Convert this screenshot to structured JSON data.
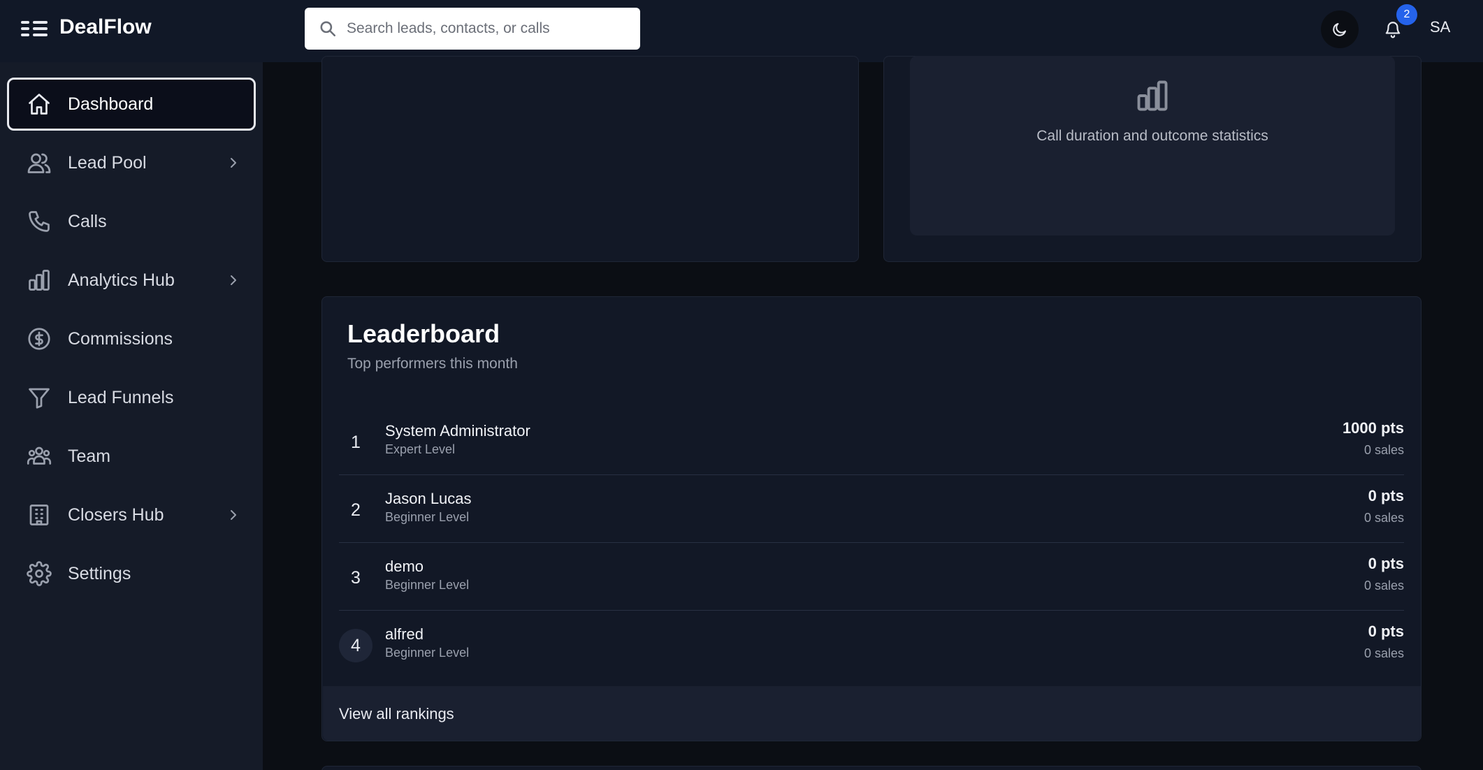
{
  "app": {
    "name": "DealFlow"
  },
  "search": {
    "placeholder": "Search leads, contacts, or calls"
  },
  "header": {
    "notification_count": "2",
    "user_initials": "SA"
  },
  "sidebar": {
    "items": [
      {
        "label": "Dashboard",
        "icon": "home-icon",
        "active": true
      },
      {
        "label": "Lead Pool",
        "icon": "users-icon",
        "has_submenu": true
      },
      {
        "label": "Calls",
        "icon": "phone-icon"
      },
      {
        "label": "Analytics Hub",
        "icon": "bar-chart-icon",
        "has_submenu": true
      },
      {
        "label": "Commissions",
        "icon": "dollar-circle-icon"
      },
      {
        "label": "Lead Funnels",
        "icon": "funnel-icon"
      },
      {
        "label": "Team",
        "icon": "team-icon"
      },
      {
        "label": "Closers Hub",
        "icon": "building-icon",
        "has_submenu": true
      },
      {
        "label": "Settings",
        "icon": "gear-icon"
      }
    ]
  },
  "call_stats": {
    "placeholder_text": "Call duration and outcome statistics",
    "icon": "bar-chart-icon"
  },
  "leaderboard": {
    "title": "Leaderboard",
    "subtitle": "Top performers this month",
    "rows": [
      {
        "rank": "1",
        "name": "System Administrator",
        "level": "Expert Level",
        "points": "1000 pts",
        "sales": "0 sales"
      },
      {
        "rank": "2",
        "name": "Jason Lucas",
        "level": "Beginner Level",
        "points": "0 pts",
        "sales": "0 sales"
      },
      {
        "rank": "3",
        "name": "demo",
        "level": "Beginner Level",
        "points": "0 pts",
        "sales": "0 sales"
      },
      {
        "rank": "4",
        "name": "alfred",
        "level": "Beginner Level",
        "points": "0 pts",
        "sales": "0 sales"
      }
    ],
    "view_all_label": "View all rankings"
  },
  "colors": {
    "accent": "#2563eb",
    "background": "#0b0e14",
    "surface": "#121826",
    "sidebar": "#151b28"
  }
}
